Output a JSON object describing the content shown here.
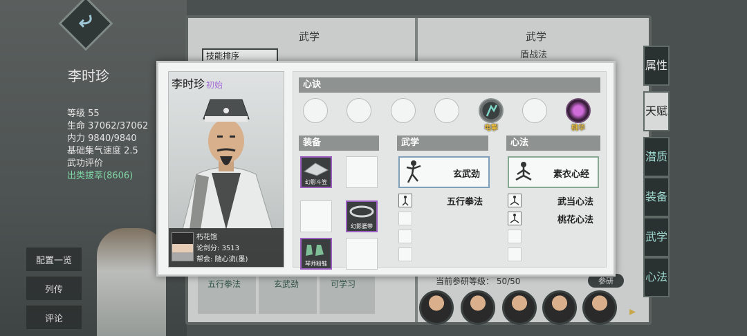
{
  "background": {
    "character_name": "李时珍",
    "stats": [
      {
        "label": "等级",
        "value": "55"
      },
      {
        "label": "生命",
        "value": "37062/37062"
      },
      {
        "label": "内力",
        "value": "9840/9840"
      },
      {
        "label": "基础集气速度",
        "value": "2.5"
      },
      {
        "label": "武功评价",
        "value": ""
      },
      {
        "label": "出类拔萃",
        "value": "(8606)"
      }
    ],
    "side_menu": [
      "配置一览",
      "列传",
      "评论"
    ],
    "book": {
      "left_title": "武学",
      "right_title": "武学",
      "right_subtitle": "盾战法",
      "sort_label": "技能排序",
      "row_items": [
        "五行拳法",
        "玄武劲",
        "可学习"
      ],
      "research_label": "当前参研等级：",
      "research_value": "50/50",
      "research_button": "参研"
    },
    "right_tabs": [
      "属性",
      "天赋",
      "潜质",
      "装备",
      "武学",
      "心法"
    ]
  },
  "modal": {
    "portrait": {
      "name": "李时珍",
      "tag": "初始",
      "tag_color": "#a36bd6",
      "guild_name": "朽花馆",
      "sword_score_label": "论剑分:",
      "sword_score": "3513",
      "faction_label": "帮会:",
      "faction": "随心流(墨)"
    },
    "xinjue": {
      "header": "心诀",
      "slots": [
        {
          "filled": false,
          "label": ""
        },
        {
          "filled": false,
          "label": ""
        },
        {
          "filled": false,
          "label": ""
        },
        {
          "filled": false,
          "label": ""
        },
        {
          "filled": true,
          "label": "电掣",
          "icon": "lightning-skill-icon"
        },
        {
          "filled": false,
          "label": ""
        },
        {
          "filled": true,
          "label": "桃华",
          "icon": "peach-blossom-icon"
        }
      ]
    },
    "equipment": {
      "header": "装备",
      "items": [
        {
          "label": "幻影斗笠",
          "rarity": "purple"
        },
        {
          "label": ""
        },
        {
          "label": ""
        },
        {
          "label": "幻影腰带",
          "rarity": "purple"
        },
        {
          "label": "琴师粉鞋",
          "rarity": "purple"
        },
        {
          "label": ""
        }
      ]
    },
    "martial": {
      "header": "武学",
      "main": "玄武劲",
      "secondary": [
        "五行拳法",
        "",
        "",
        ""
      ]
    },
    "mind": {
      "header": "心法",
      "main": "素衣心经",
      "secondary": [
        "武当心法",
        "桃花心法",
        "",
        ""
      ]
    }
  }
}
